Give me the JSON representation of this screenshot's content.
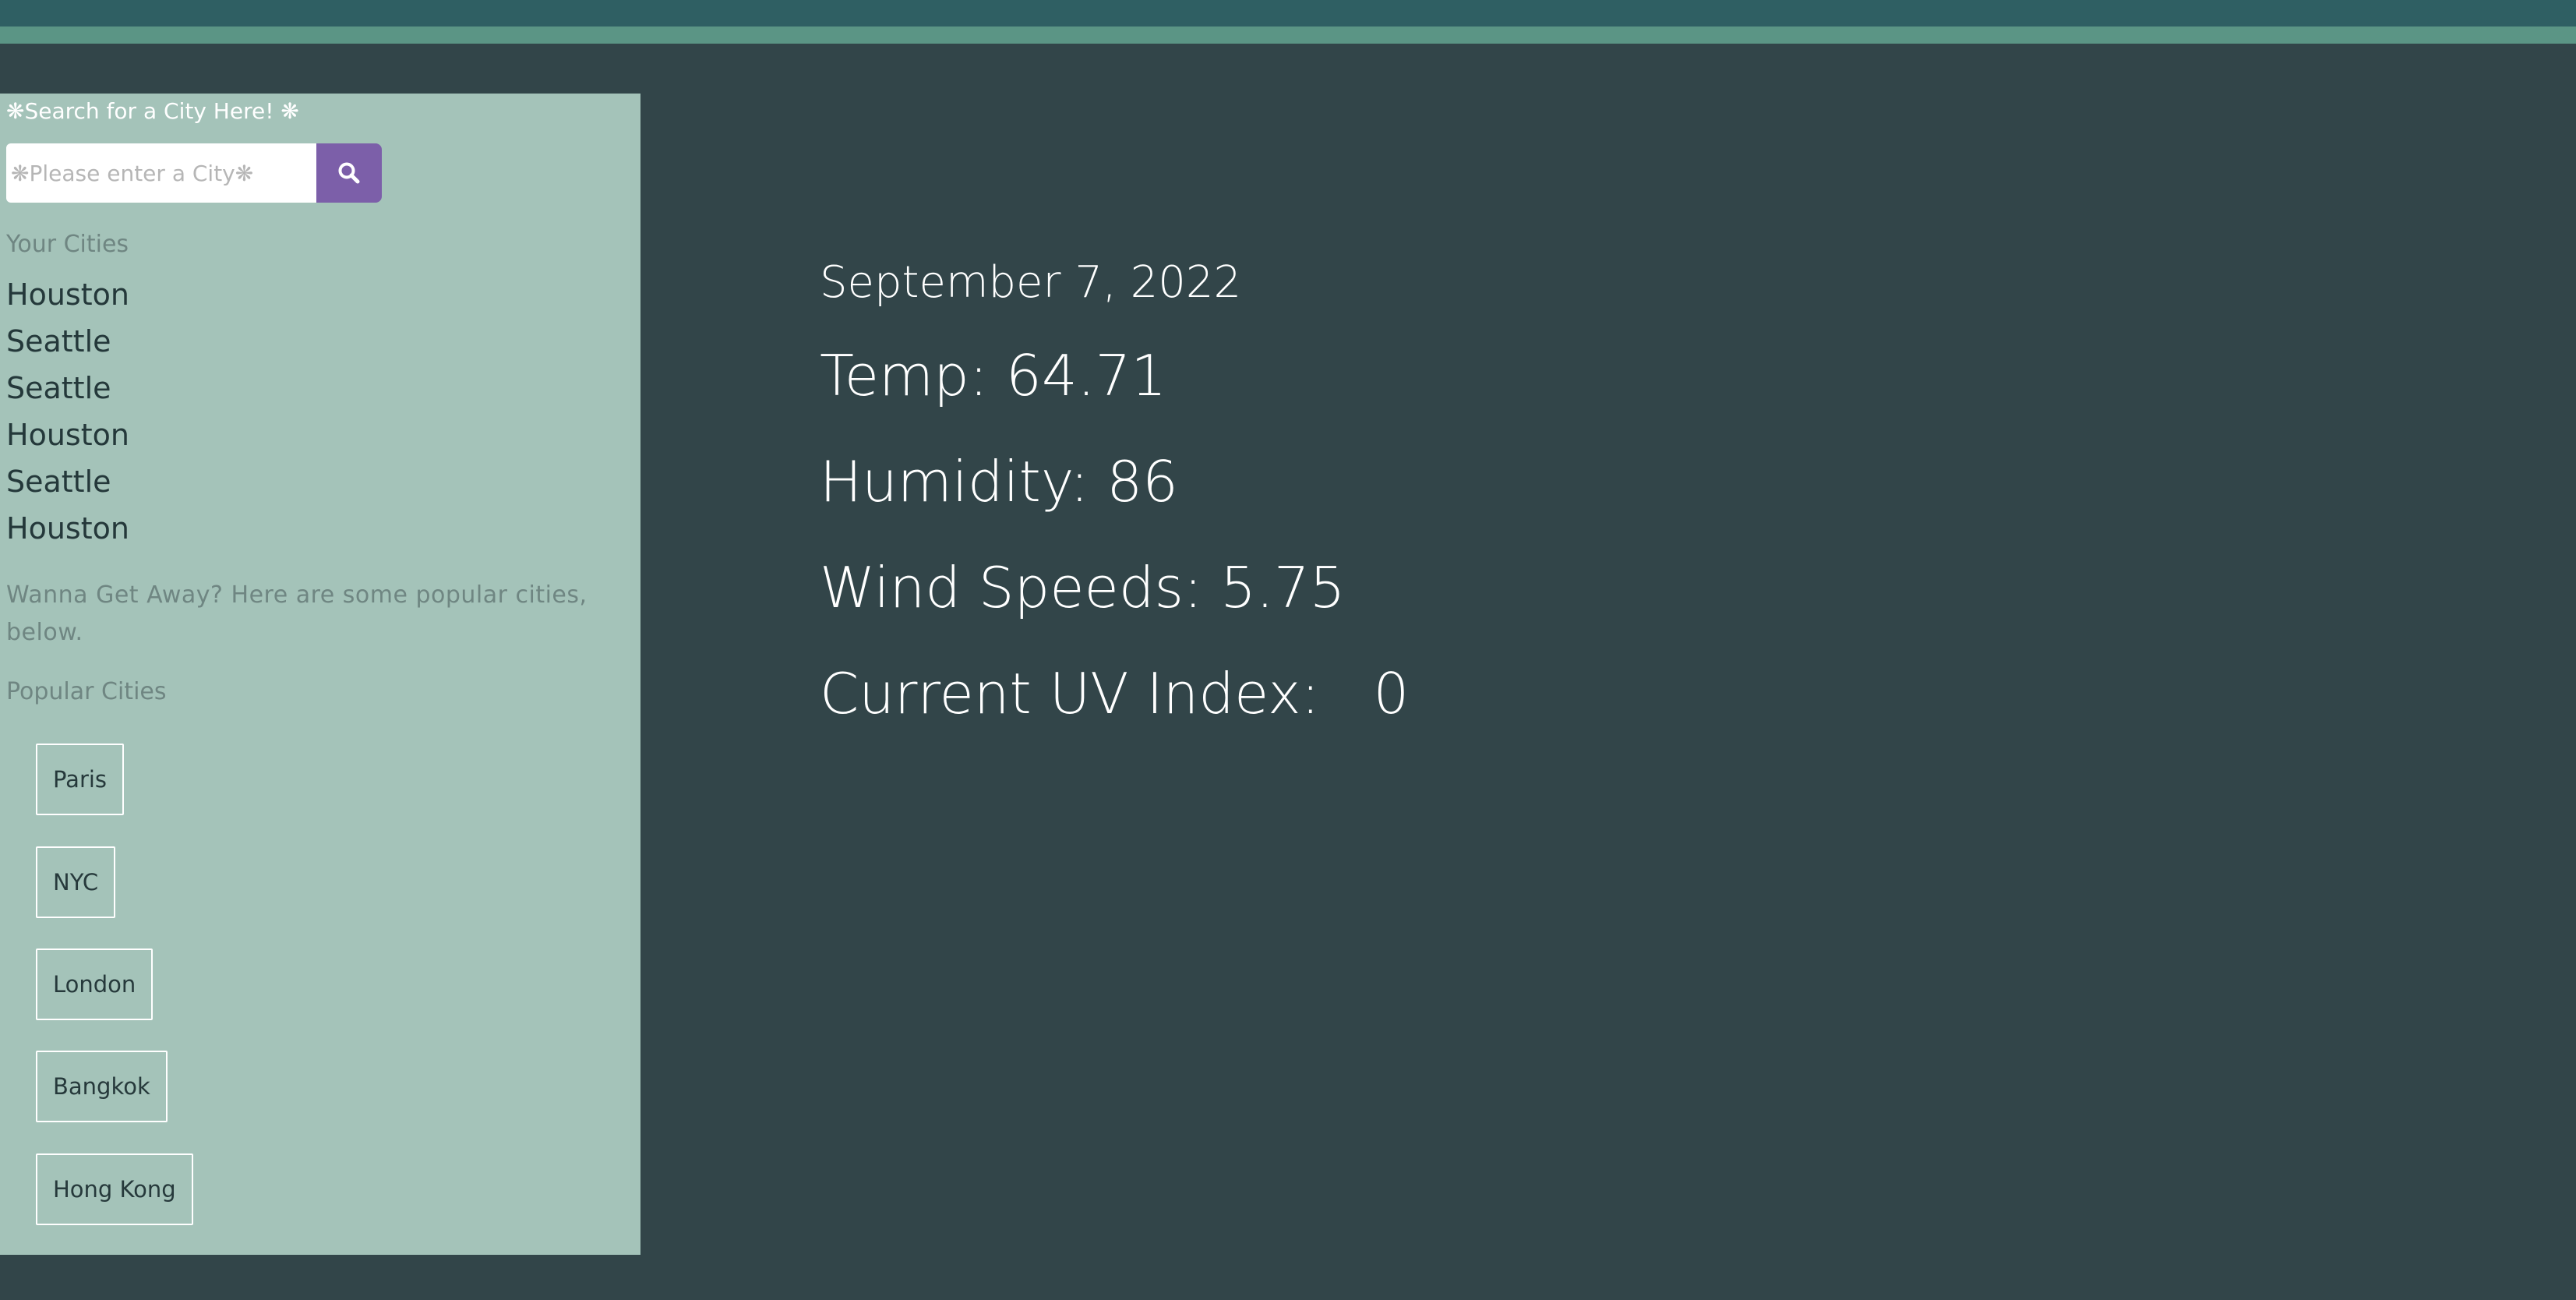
{
  "search": {
    "title": "❋Search for a City Here! ❋",
    "placeholder": "❋Please enter a City❋",
    "value": "",
    "button_icon": "search-icon"
  },
  "your_cities": {
    "heading": "Your Cities",
    "items": [
      "Houston",
      "Seattle",
      "Seattle",
      "Houston",
      "Seattle",
      "Houston"
    ]
  },
  "getaway_text": "Wanna Get Away? Here are some popular cities, below.",
  "popular_cities": {
    "heading": "Popular Cities",
    "items": [
      "Paris",
      "NYC",
      "London",
      "Bangkok",
      "Hong Kong"
    ]
  },
  "weather": {
    "date": "September 7, 2022",
    "temp": "Temp: 64.71",
    "humidity": "Humidity: 86",
    "wind": "Wind Speeds: 5.75",
    "uv": "Current UV Index:   0"
  },
  "colors": {
    "background": "#324549",
    "sidebar": "#a4c3b9",
    "top_bar": "#2f5f63",
    "top_stripe": "#5b9585",
    "search_button": "#7c5fa9"
  }
}
